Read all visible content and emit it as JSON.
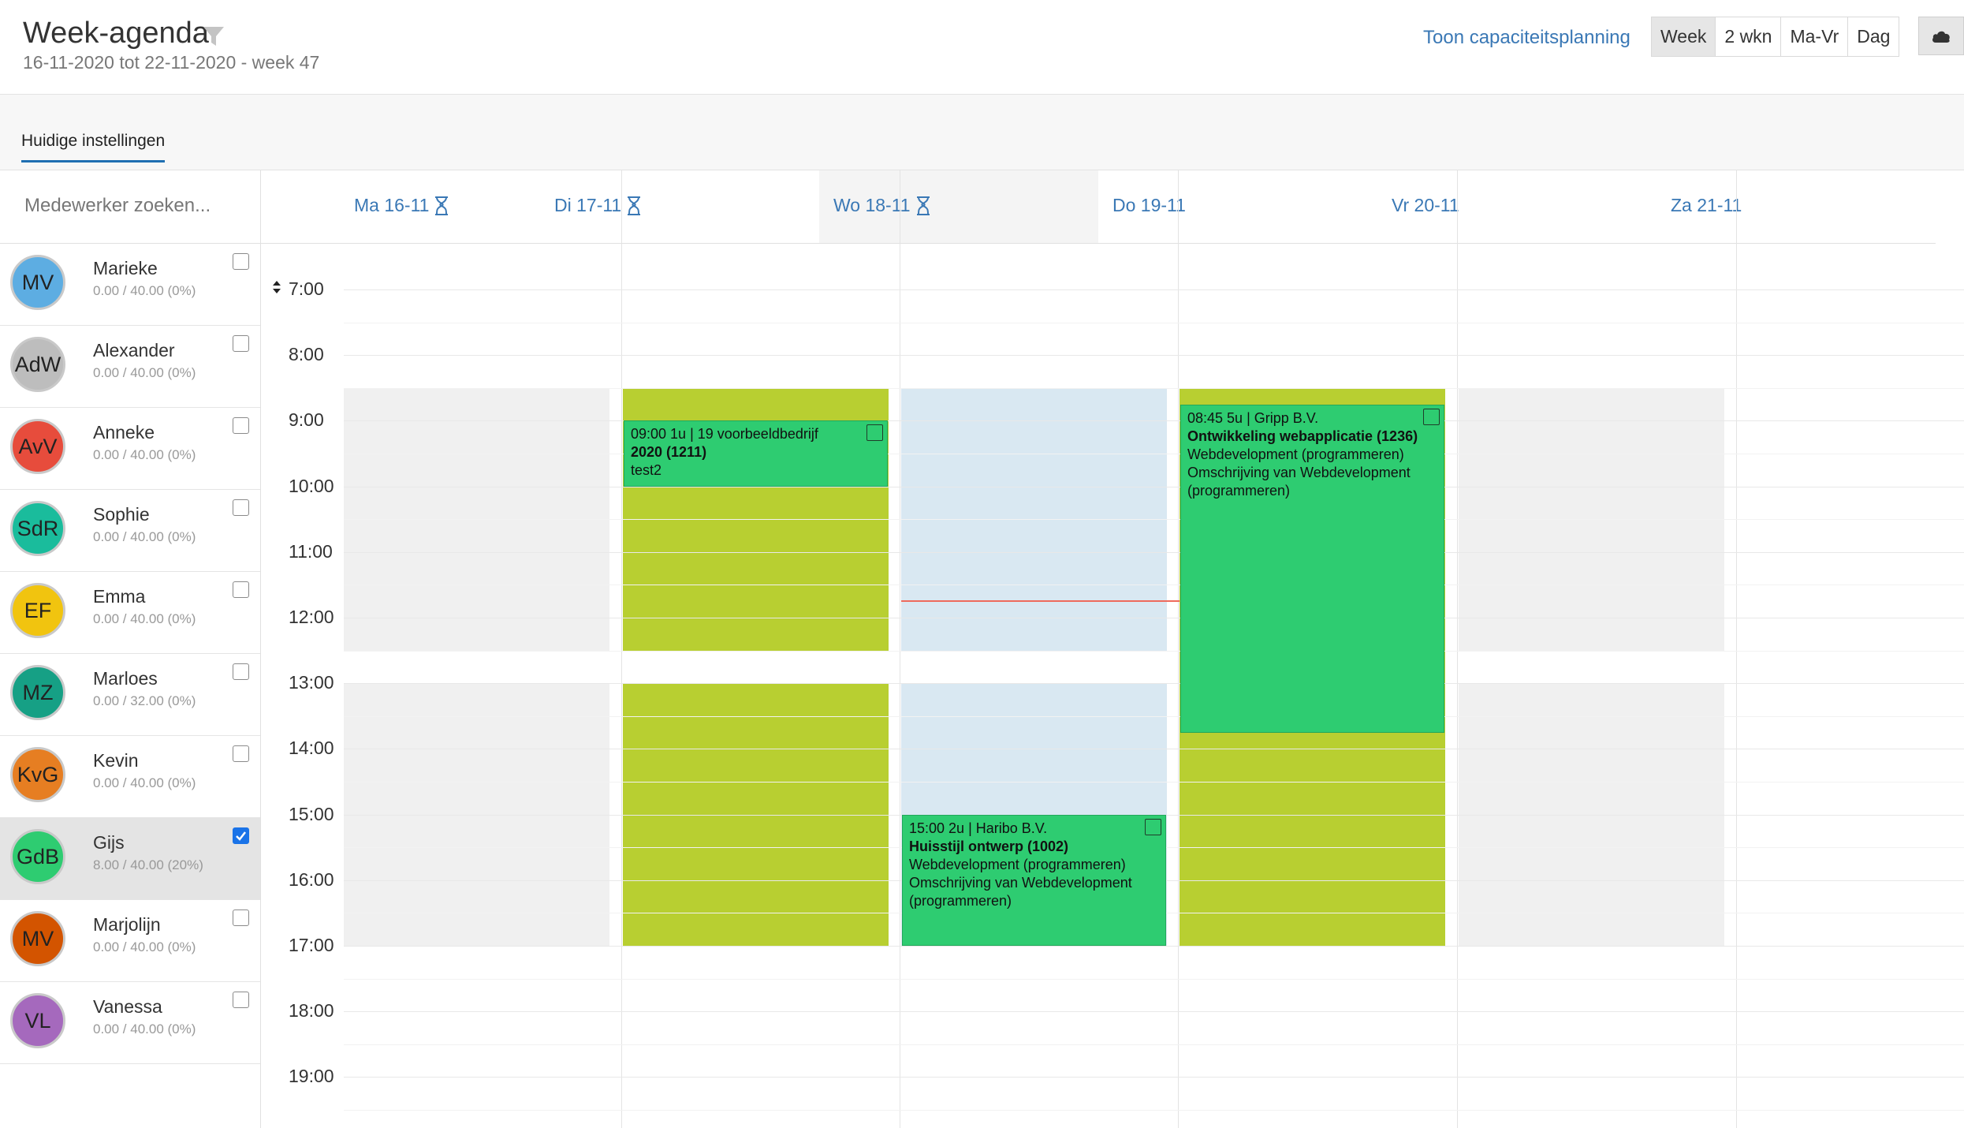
{
  "header": {
    "title": "Week-agenda",
    "subtitle": "16-11-2020 tot 22-11-2020 - week 47",
    "capacity_link": "Toon capaciteitsplanning",
    "views": [
      "Week",
      "2 wkn",
      "Ma-Vr",
      "Dag"
    ],
    "active_view": "Week"
  },
  "settings_tab": "Huidige instellingen",
  "search": {
    "placeholder": "Medewerker zoeken..."
  },
  "employees": [
    {
      "initials": "MV",
      "name": "Marieke",
      "hours": "0.00 / 40.00 (0%)",
      "color": "#5dade2",
      "checked": false
    },
    {
      "initials": "AdW",
      "name": "Alexander",
      "hours": "0.00 / 40.00 (0%)",
      "color": "#bdbdbd",
      "checked": false
    },
    {
      "initials": "AvV",
      "name": "Anneke",
      "hours": "0.00 / 40.00 (0%)",
      "color": "#e74c3c",
      "checked": false
    },
    {
      "initials": "SdR",
      "name": "Sophie",
      "hours": "0.00 / 40.00 (0%)",
      "color": "#1abc9c",
      "checked": false
    },
    {
      "initials": "EF",
      "name": "Emma",
      "hours": "0.00 / 40.00 (0%)",
      "color": "#f1c40f",
      "checked": false
    },
    {
      "initials": "MZ",
      "name": "Marloes",
      "hours": "0.00 / 32.00 (0%)",
      "color": "#16a085",
      "checked": false
    },
    {
      "initials": "KvG",
      "name": "Kevin",
      "hours": "0.00 / 40.00 (0%)",
      "color": "#e67e22",
      "checked": false
    },
    {
      "initials": "GdB",
      "name": "Gijs",
      "hours": "8.00 / 40.00 (20%)",
      "color": "#2ecc71",
      "checked": true
    },
    {
      "initials": "MV",
      "name": "Marjolijn",
      "hours": "0.00 / 40.00 (0%)",
      "color": "#d35400",
      "checked": false
    },
    {
      "initials": "VL",
      "name": "Vanessa",
      "hours": "0.00 / 40.00 (0%)",
      "color": "#a569bd",
      "checked": false
    }
  ],
  "days": [
    {
      "label": "Ma 16-11",
      "hourglass": true
    },
    {
      "label": "Di 17-11",
      "hourglass": true
    },
    {
      "label": "Wo 18-11",
      "hourglass": true
    },
    {
      "label": "Do 19-11",
      "hourglass": false
    },
    {
      "label": "Vr 20-11",
      "hourglass": false
    },
    {
      "label": "Za 21-11",
      "hourglass": false
    }
  ],
  "times": [
    "7:00",
    "8:00",
    "9:00",
    "10:00",
    "11:00",
    "12:00",
    "13:00",
    "14:00",
    "15:00",
    "16:00",
    "17:00",
    "18:00",
    "19:00"
  ],
  "colors": {
    "available_gray": "#f0f0f0",
    "available_today": "#d9e8f2",
    "planned_olive": "#b8cf31",
    "event_green": "#2ecc71",
    "now_line": "#ee6a5c",
    "link_blue": "#3a78b5"
  },
  "events": [
    {
      "line1": "09:00 1u | 19 voorbeeldbedrijf",
      "title": "2020 (1211)",
      "desc1": "test2",
      "desc2": ""
    },
    {
      "line1": "15:00 2u | Haribo B.V.",
      "title": "Huisstijl ontwerp (1002)",
      "desc1": "Webdevelopment (programmeren)",
      "desc2": "Omschrijving van Webdevelopment (programmeren)"
    },
    {
      "line1": "08:45 5u | Gripp B.V.",
      "title": "Ontwikkeling webapplicatie (1236)",
      "desc1": "Webdevelopment (programmeren)",
      "desc2": "Omschrijving van Webdevelopment (programmeren)"
    }
  ]
}
